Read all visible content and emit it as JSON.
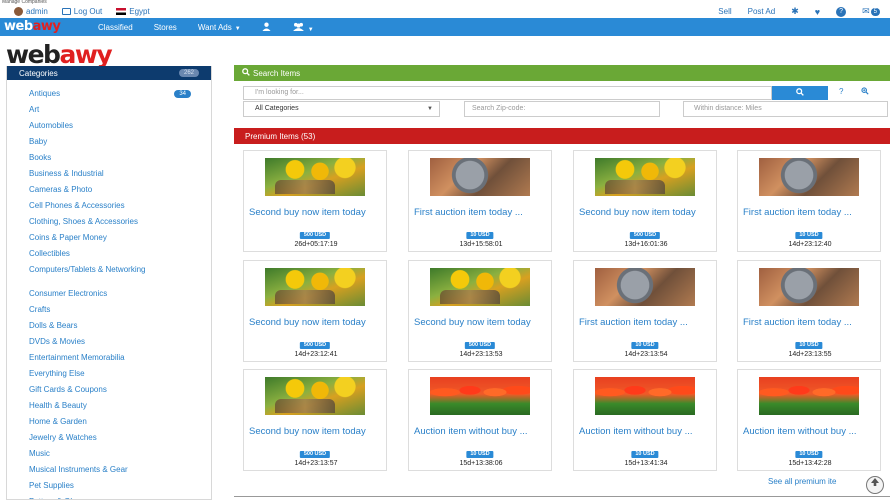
{
  "caption": "Manage Companies",
  "topbar": {
    "user": "admin",
    "logout": "Log Out",
    "country": "Egypt",
    "sell": "Sell",
    "post_ad": "Post Ad",
    "messages_count": "5"
  },
  "nav": {
    "brand_a": "web",
    "brand_b": "awy",
    "links": [
      "Classified",
      "Stores",
      "Want Ads"
    ]
  },
  "logo": {
    "a": "web",
    "b": "awy"
  },
  "sidebar": {
    "title": "Categories",
    "total": "262",
    "items": [
      {
        "label": "Antiques",
        "count": "34"
      },
      {
        "label": "Art"
      },
      {
        "label": "Automobiles"
      },
      {
        "label": "Baby"
      },
      {
        "label": "Books"
      },
      {
        "label": "Business & Industrial"
      },
      {
        "label": "Cameras & Photo"
      },
      {
        "label": "Cell Phones & Accessories"
      },
      {
        "label": "Clothing, Shoes & Accessories"
      },
      {
        "label": "Coins & Paper Money"
      },
      {
        "label": "Collectibles"
      },
      {
        "label": "Computers/Tablets & Networking"
      },
      {
        "label": "Consumer Electronics"
      },
      {
        "label": "Crafts"
      },
      {
        "label": "Dolls & Bears"
      },
      {
        "label": "DVDs & Movies"
      },
      {
        "label": "Entertainment Memorabilia"
      },
      {
        "label": "Everything Else"
      },
      {
        "label": "Gift Cards & Coupons"
      },
      {
        "label": "Health & Beauty"
      },
      {
        "label": "Home & Garden"
      },
      {
        "label": "Jewelry & Watches"
      },
      {
        "label": "Music"
      },
      {
        "label": "Musical Instruments & Gear"
      },
      {
        "label": "Pet Supplies"
      },
      {
        "label": "Pottery & Glass"
      }
    ]
  },
  "search": {
    "title": "Search Items",
    "placeholder": "I'm looking for...",
    "help": "?",
    "category_selected": "All Categories",
    "zip_placeholder": "Search Zip-code:",
    "distance_placeholder": "Within distance: Miles"
  },
  "premium": {
    "title": "Premium Items (53)",
    "see_all": "See all premium ite",
    "items": [
      {
        "title": "Second buy now item today",
        "price": "500 USD",
        "time": "26d+05:17:19",
        "img": "sunflower"
      },
      {
        "title": "First auction item today ...",
        "price": "10 USD",
        "time": "13d+15:58:01",
        "img": "clock"
      },
      {
        "title": "Second buy now item today",
        "price": "500 USD",
        "time": "13d+16:01:36",
        "img": "sunflower"
      },
      {
        "title": "First auction item today ...",
        "price": "10 USD",
        "time": "14d+23:12:40",
        "img": "clock"
      },
      {
        "title": "Second buy now item today",
        "price": "500 USD",
        "time": "14d+23:12:41",
        "img": "sunflower"
      },
      {
        "title": "Second buy now item today",
        "price": "500 USD",
        "time": "14d+23:13:53",
        "img": "sunflower"
      },
      {
        "title": "First auction item today ...",
        "price": "10 USD",
        "time": "14d+23:13:54",
        "img": "clock"
      },
      {
        "title": "First auction item today ...",
        "price": "10 USD",
        "time": "14d+23:13:55",
        "img": "clock"
      },
      {
        "title": "Second buy now item today",
        "price": "500 USD",
        "time": "14d+23:13:57",
        "img": "sunflower"
      },
      {
        "title": "Auction item without buy ...",
        "price": "10 USD",
        "time": "15d+13:38:06",
        "img": "tulips"
      },
      {
        "title": "Auction item without buy ...",
        "price": "10 USD",
        "time": "15d+13:41:34",
        "img": "tulips"
      },
      {
        "title": "Auction item without buy ...",
        "price": "10 USD",
        "time": "15d+13:42:28",
        "img": "tulips"
      }
    ]
  }
}
